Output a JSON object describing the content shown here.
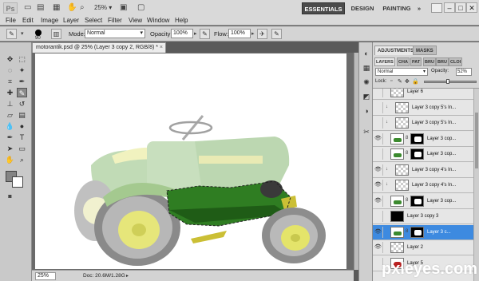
{
  "app": {
    "logo": "Ps",
    "zoom": "25%",
    "workspaces": [
      "ESSENTIALS",
      "DESIGN",
      "PAINTING",
      "»"
    ],
    "window_controls": [
      "–",
      "□",
      "✕"
    ]
  },
  "menu": [
    "File",
    "Edit",
    "Image",
    "Layer",
    "Select",
    "Filter",
    "View",
    "Window",
    "Help"
  ],
  "options": {
    "brush_size": "90",
    "mode_label": "Mode:",
    "mode_value": "Normal",
    "opacity_label": "Opacity:",
    "opacity_value": "100%",
    "flow_label": "Flow:",
    "flow_value": "100%"
  },
  "document": {
    "tab_title": "motorantik.psd @ 25% (Layer 3 copy 2, RGB/8) *",
    "tab_close": "×",
    "zoom": "25%",
    "status": "Doc: 20.6M/1.28G",
    "status_arrow": "▸"
  },
  "panels": {
    "adjustments_tabs": [
      "ADJUSTMENTS",
      "MASKS"
    ],
    "layer_tabs": [
      "LAYERS",
      "CHA",
      "PAT",
      "BRU",
      "BRU",
      "CLOI"
    ],
    "blend_mode": "Normal",
    "opacity_label": "Opacity:",
    "opacity_value": "52%",
    "lock_label": "Lock:",
    "layers": [
      {
        "name": "Layer 6",
        "eye": false,
        "link": false,
        "thumb": "checker",
        "mask": false
      },
      {
        "name": "Layer 3 copy 5's In...",
        "eye": false,
        "link": true,
        "thumb": "checker",
        "mask": false
      },
      {
        "name": "Layer 3 copy 5's In...",
        "eye": false,
        "link": true,
        "thumb": "checker",
        "mask": false
      },
      {
        "name": "Layer 3 cop...",
        "eye": true,
        "link": false,
        "thumb": "tractor",
        "mask": true
      },
      {
        "name": "Layer 3 cop...",
        "eye": false,
        "link": false,
        "thumb": "tractor",
        "mask": true
      },
      {
        "name": "Layer 3 copy 4's In...",
        "eye": true,
        "link": true,
        "thumb": "checker",
        "mask": false
      },
      {
        "name": "Layer 3 copy 4's In...",
        "eye": true,
        "link": true,
        "thumb": "checker",
        "mask": false
      },
      {
        "name": "Layer 3 cop...",
        "eye": true,
        "link": false,
        "thumb": "tractor",
        "mask": true
      },
      {
        "name": "Layer 3 copy 3",
        "eye": false,
        "link": false,
        "thumb": "black",
        "mask": false
      },
      {
        "name": "Layer 3 c...",
        "eye": true,
        "link": false,
        "thumb": "tractor",
        "mask": true,
        "selected": true
      },
      {
        "name": "Layer 2",
        "eye": true,
        "link": false,
        "thumb": "checker",
        "mask": false
      },
      {
        "name": "Layer 5",
        "eye": false,
        "link": false,
        "thumb": "red",
        "mask": false
      }
    ]
  },
  "watermark": {
    "text": "pxleyes.com"
  },
  "colors": {
    "selected_layer": "#3d8ae0",
    "tractor_green": "#2f7d22",
    "tractor_yellow": "#e4e46a",
    "ghost_green": "#a9c99c"
  }
}
